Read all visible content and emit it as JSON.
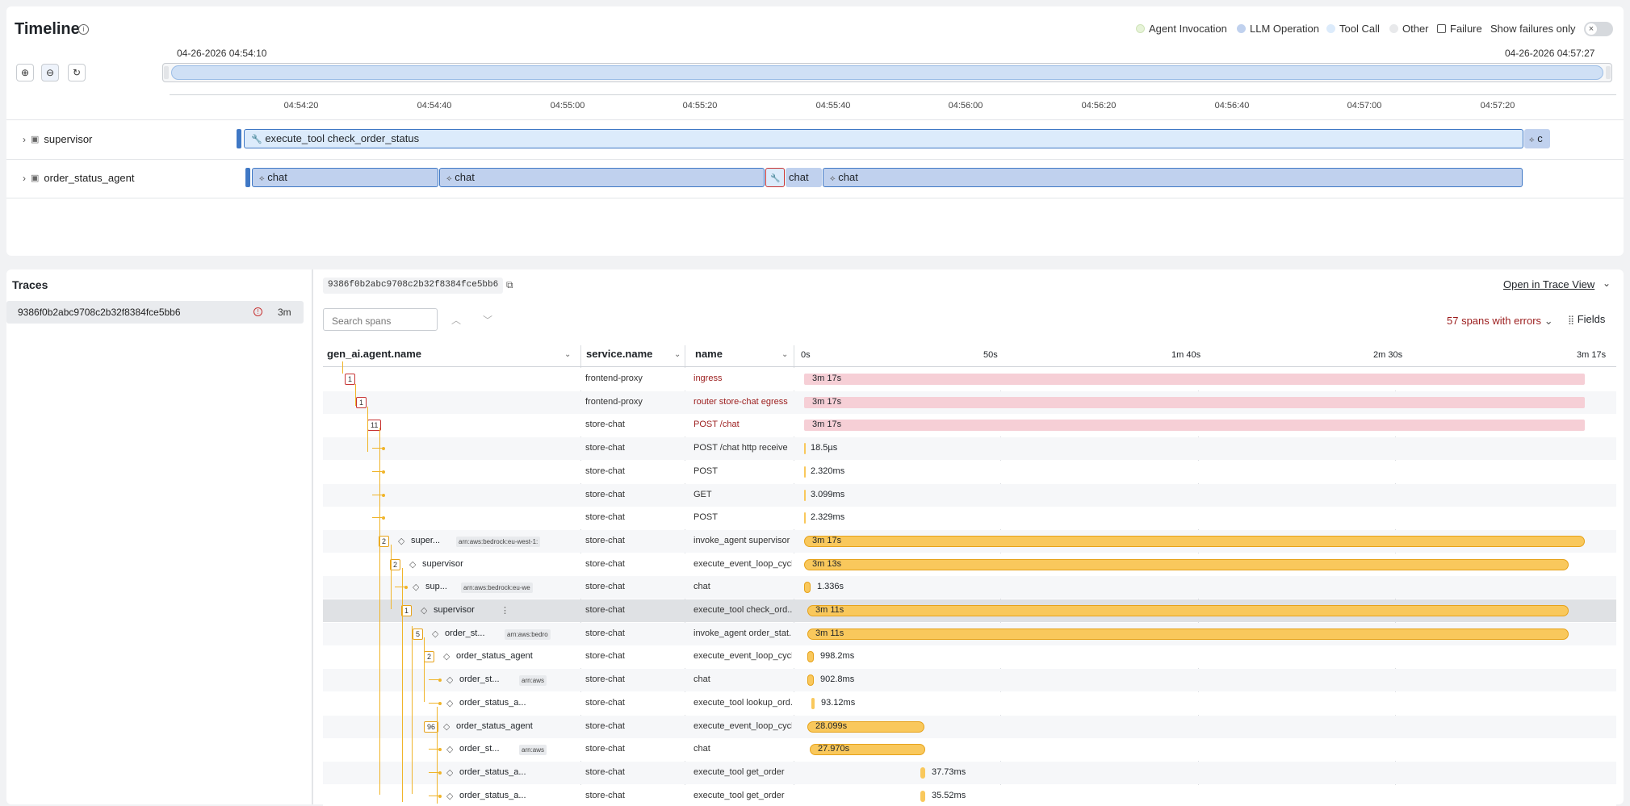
{
  "timeline": {
    "title": "Timeline",
    "start_time": "04-26-2026 04:54:10",
    "end_time": "04-26-2026 04:57:27",
    "legend": {
      "agent": "Agent Invocation",
      "llm": "LLM Operation",
      "tool": "Tool Call",
      "other": "Other",
      "failure": "Failure",
      "failures_only": "Show failures only"
    },
    "ticks": [
      "04:54:20",
      "04:54:40",
      "04:55:00",
      "04:55:20",
      "04:55:40",
      "04:56:00",
      "04:56:20",
      "04:56:40",
      "04:57:00",
      "04:57:20"
    ],
    "rows": [
      {
        "label": "supervisor",
        "segment": "execute_tool check_order_status",
        "tail": "c"
      },
      {
        "label": "order_status_agent",
        "segments": [
          "chat",
          "chat",
          "chat",
          "chat"
        ]
      }
    ]
  },
  "traces": {
    "title": "Traces",
    "trace_id": "9386f0b2abc9708c2b32f8384fce5bb6",
    "duration": "3m",
    "selected_trace_id": "9386f0b2abc9708c2b32f8384fce5bb6",
    "open_in_trace_view": "Open in Trace View",
    "search_placeholder": "Search spans",
    "errors_label": "57 spans with errors",
    "fields_label": "Fields",
    "columns": [
      "gen_ai.agent.name",
      "service.name",
      "name"
    ],
    "time_ticks": [
      "0s",
      "50s",
      "1m 40s",
      "2m 30s",
      "3m 17s"
    ],
    "rows": [
      {
        "badge": "1",
        "agent": "",
        "tag": "",
        "service": "frontend-proxy",
        "name": "ingress",
        "dur": "3m 17s",
        "error": true
      },
      {
        "badge": "1",
        "agent": "",
        "tag": "",
        "service": "frontend-proxy",
        "name": "router store-chat egress",
        "dur": "3m 17s",
        "error": true
      },
      {
        "badge": "11",
        "agent": "",
        "tag": "",
        "service": "store-chat",
        "name": "POST /chat",
        "dur": "3m 17s",
        "error": true
      },
      {
        "badge": "",
        "agent": "",
        "tag": "",
        "service": "store-chat",
        "name": "POST /chat http receive",
        "dur": "18.5µs",
        "error": false
      },
      {
        "badge": "",
        "agent": "",
        "tag": "",
        "service": "store-chat",
        "name": "POST",
        "dur": "2.320ms",
        "error": false
      },
      {
        "badge": "",
        "agent": "",
        "tag": "",
        "service": "store-chat",
        "name": "GET",
        "dur": "3.099ms",
        "error": false
      },
      {
        "badge": "",
        "agent": "",
        "tag": "",
        "service": "store-chat",
        "name": "POST",
        "dur": "2.329ms",
        "error": false
      },
      {
        "badge": "2",
        "agent": "super...",
        "tag": "arn:aws:bedrock:eu-west-1:",
        "service": "store-chat",
        "name": "invoke_agent supervisor",
        "dur": "3m 17s",
        "error": false
      },
      {
        "badge": "2",
        "agent": "supervisor",
        "tag": "",
        "service": "store-chat",
        "name": "execute_event_loop_cycle",
        "dur": "3m 13s",
        "error": false
      },
      {
        "badge": "",
        "agent": "sup...",
        "tag": "arn:aws:bedrock:eu-we",
        "service": "store-chat",
        "name": "chat",
        "dur": "1.336s",
        "error": false
      },
      {
        "badge": "1",
        "agent": "supervisor",
        "tag": "",
        "service": "store-chat",
        "name": "execute_tool check_ord...",
        "dur": "3m 11s",
        "error": false
      },
      {
        "badge": "5",
        "agent": "order_st...",
        "tag": "arn:aws:bedro",
        "service": "store-chat",
        "name": "invoke_agent order_stat...",
        "dur": "3m 11s",
        "error": false
      },
      {
        "badge": "2",
        "agent": "order_status_agent",
        "tag": "",
        "service": "store-chat",
        "name": "execute_event_loop_cycle",
        "dur": "998.2ms",
        "error": false
      },
      {
        "badge": "",
        "agent": "order_st...",
        "tag": "arn:aws",
        "service": "store-chat",
        "name": "chat",
        "dur": "902.8ms",
        "error": false
      },
      {
        "badge": "",
        "agent": "order_status_a...",
        "tag": "",
        "service": "store-chat",
        "name": "execute_tool lookup_ord...",
        "dur": "93.12ms",
        "error": false
      },
      {
        "badge": "96",
        "agent": "order_status_agent",
        "tag": "",
        "service": "store-chat",
        "name": "execute_event_loop_cycle",
        "dur": "28.099s",
        "error": false
      },
      {
        "badge": "",
        "agent": "order_st...",
        "tag": "arn:aws",
        "service": "store-chat",
        "name": "chat",
        "dur": "27.970s",
        "error": false
      },
      {
        "badge": "",
        "agent": "order_status_a...",
        "tag": "",
        "service": "store-chat",
        "name": "execute_tool get_order",
        "dur": "37.73ms",
        "error": false
      },
      {
        "badge": "",
        "agent": "order_status_a...",
        "tag": "",
        "service": "store-chat",
        "name": "execute_tool get_order",
        "dur": "35.52ms",
        "error": false
      }
    ]
  },
  "colors": {
    "error_bar": "#f6cfd6",
    "ok_bar": "#f9c85c",
    "llm": "#c0d1ee",
    "tool": "#dcebfb",
    "error_text": "#9b1c1c"
  }
}
